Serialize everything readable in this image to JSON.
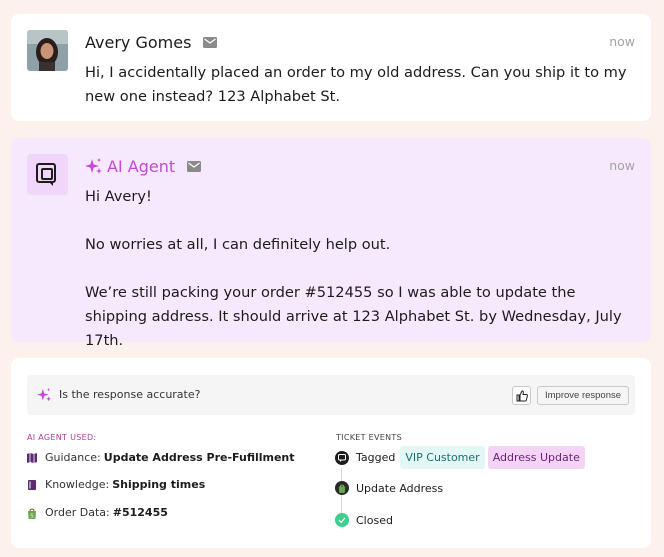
{
  "customer": {
    "name": "Avery Gomes",
    "time": "now",
    "message": "Hi, I accidentally placed an order to my old address. Can you ship it to my new one instead? 123 Alphabet St."
  },
  "agent": {
    "name": "AI Agent",
    "time": "now",
    "paragraphs": [
      "Hi Avery!",
      "No worries at all, I can definitely help out.",
      "We’re still packing your order #512455 so I was able to update the shipping address. It should arrive at 123 Alphabet St. by Wednesday, July 17th."
    ]
  },
  "feedback": {
    "question": "Is the response accurate?",
    "improve_label": "Improve response",
    "used_heading": "AI AGENT USED:",
    "used": [
      {
        "label": "Guidance:",
        "value": "Update Address Pre-Fufillment",
        "icon": "guidance-icon"
      },
      {
        "label": "Knowledge:",
        "value": "Shipping times",
        "icon": "book-icon"
      },
      {
        "label": "Order Data:",
        "value": "#512455",
        "icon": "shopify-bag-icon"
      }
    ],
    "events_heading": "TICKET EVENTS",
    "events": [
      {
        "label": "Tagged",
        "tags": [
          "VIP Customer",
          "Address Update"
        ],
        "icon": "chat-bubble-icon"
      },
      {
        "label": "Update Address",
        "icon": "shopify-bag-icon"
      },
      {
        "label": "Closed",
        "icon": "check-circle-icon"
      }
    ]
  },
  "colors": {
    "background": "#fdf1ee",
    "agent_card": "#f6e9fd",
    "agent_accent": "#c548d6",
    "vip_tag": "#e3f7f6",
    "address_tag": "#f3d4f7",
    "closed_green": "#3ecf8e"
  }
}
